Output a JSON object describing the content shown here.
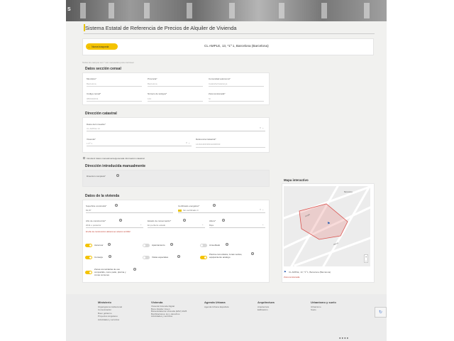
{
  "header": {
    "logo": "S"
  },
  "page_title": "Sistema Estatal de Referencia de Precios de Alquiler de Vivienda",
  "back_button": {
    "label": "Nueva búsqueda"
  },
  "address": "CL AMPLE, 13, *1º 1, Barcelona (Barcelona)",
  "required_note": "Todos los campos con * son necesarios para continuar",
  "censal": {
    "title": "Datos sección censal",
    "fields": [
      {
        "label": "Municipio*",
        "value": "Barcelona"
      },
      {
        "label": "Provincia*",
        "value": "Barcelona"
      },
      {
        "label": "Comunidad autónoma*",
        "value": "Cataluña/Catalunya"
      },
      {
        "label": "Código censal*",
        "value": "0801902011"
      },
      {
        "label": "Número de testigos*",
        "value": "144"
      },
      {
        "label": "Zona tensionada*",
        "value": "Sí"
      }
    ]
  },
  "catastral": {
    "title": "Dirección catastral",
    "street_label": "Datos del inmueble*",
    "street_value": "CL AMPLE 13",
    "vivienda_label": "Vivienda*",
    "vivienda_value": "1 Pº 1",
    "ref_label": "Referencia Catastral*",
    "ref_value": "1416113DF3813A0006SF"
  },
  "manual_check": "Introducir datos manualmente/generada información catastral",
  "manual": {
    "title": "Dirección introducida manualmente",
    "label": "Dirección completa*"
  },
  "vivienda": {
    "title": "Datos de la vivienda",
    "superficie_label": "Superficie construida*",
    "superficie_value": "81,87",
    "cert_label": "Certificado energético*",
    "cert_value": "Sin certificado C",
    "anio_label": "Año de construcción*",
    "anio_value": "2011 o posterior",
    "anio_hint": "El año de construcción deberá ser anterior al 2022",
    "estado_label": "Estado de conservación*",
    "estado_value": "En perfecto estado",
    "altura_label": "Altura*",
    "altura_value": "Baja",
    "toggles": [
      {
        "label": "Ascensor",
        "state": "on"
      },
      {
        "label": "Aparcamiento",
        "state": "off"
      },
      {
        "label": "Amueblado",
        "state": "off"
      },
      {
        "label": "Conserje",
        "state": "on"
      },
      {
        "label": "Vistas especiales",
        "state": "off"
      },
      {
        "label": "Piscina comunitaria, zonas verdes, equipamiento análogo",
        "state": "on"
      },
      {
        "label": "Zonas comunitarias de uso compartido, como patio, piscina y zonas comunes",
        "state": "on"
      }
    ]
  },
  "map": {
    "title": "Mapa interactivo",
    "caption": "CL AMPLE, 13, *1º 1, Barcelona (Barcelona)",
    "link": "Zona tensionada",
    "street_labels": [
      "Barcelona",
      "Ample",
      "Mercè"
    ]
  },
  "footer": {
    "columns": [
      {
        "heading": "Ministerio",
        "items": [
          "Organigrama institucional",
          "Comunicación",
          "Buen gobierno",
          "Proyectos singulares",
          "Actividades y servicios"
        ]
      },
      {
        "heading": "Vivienda",
        "items": [
          "Vivienda Vivienda Digital",
          "Bono Alquiler Joven",
          "Bolsa Estatal de Vivienda (ESV) 2025",
          "Bonificaciones, ley y derechos",
          "Actividades y servicios"
        ]
      },
      {
        "heading": "Agenda Urbana",
        "items": [
          "Agenda Urbana Española"
        ]
      },
      {
        "heading": "Arquitectura",
        "items": [
          "Arquitectura",
          "Edificación"
        ]
      },
      {
        "heading": "Urbanismo y suelo",
        "items": [
          "Urbanismo",
          "Suelo"
        ]
      }
    ]
  },
  "colors": {
    "accent": "#f4c300",
    "link": "#c0392b",
    "polygon": "#e3706a"
  }
}
